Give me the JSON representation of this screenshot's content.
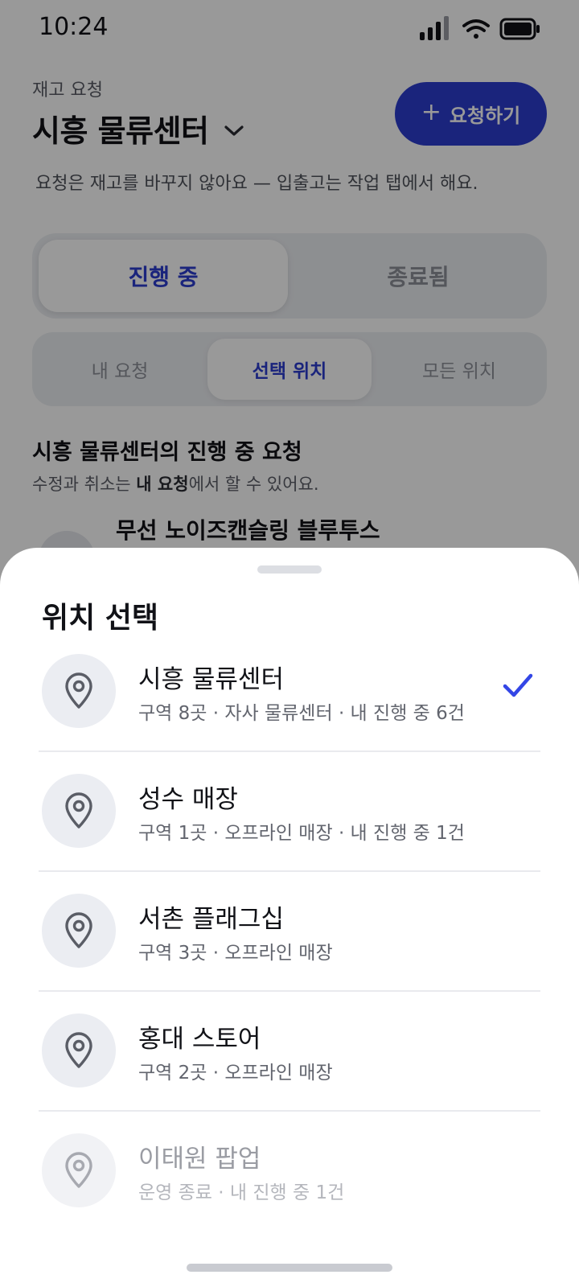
{
  "status_bar": {
    "time": "10:24"
  },
  "header": {
    "eyebrow": "재고 요청",
    "title": "시흥 물류센터",
    "cta_label": "요청하기",
    "subtitle": "요청은 재고를 바꾸지 않아요 — 입출고는 작업 탭에서 해요."
  },
  "status_tabs": [
    {
      "label": "진행 중",
      "selected": true
    },
    {
      "label": "종료됨",
      "selected": false
    }
  ],
  "scope_tabs": [
    {
      "label": "내 요청",
      "selected": false
    },
    {
      "label": "선택 위치",
      "selected": true
    },
    {
      "label": "모든 위치",
      "selected": false
    }
  ],
  "section": {
    "title": "시흥 물류센터의 진행 중 요청",
    "sub_prefix": "수정과 취소는 ",
    "sub_bold": "내 요청",
    "sub_suffix": "에서 할 수 있어요."
  },
  "peek_item": {
    "title": "무선 노이즈캔슬링 블루투스"
  },
  "sheet": {
    "title": "위치 선택",
    "locations": [
      {
        "name": "시흥 물류센터",
        "meta": "구역 8곳 · 자사 물류센터 · 내 진행 중 6건",
        "selected": true,
        "disabled": false,
        "icon": "map-pin-icon"
      },
      {
        "name": "성수 매장",
        "meta": "구역 1곳 · 오프라인 매장 · 내 진행 중 1건",
        "selected": false,
        "disabled": false,
        "icon": "map-pin-icon"
      },
      {
        "name": "서촌 플래그십",
        "meta": "구역 3곳 · 오프라인 매장",
        "selected": false,
        "disabled": false,
        "icon": "map-pin-icon"
      },
      {
        "name": "홍대 스토어",
        "meta": "구역 2곳 · 오프라인 매장",
        "selected": false,
        "disabled": false,
        "icon": "map-pin-icon"
      },
      {
        "name": "이태원 팝업",
        "meta": "운영 종료 · 내 진행 중 1건",
        "selected": false,
        "disabled": true,
        "icon": "map-pin-icon"
      }
    ]
  },
  "colors": {
    "accent": "#2c3ccf",
    "check": "#3346e6",
    "scrim": "rgba(0,0,0,0.40)"
  }
}
